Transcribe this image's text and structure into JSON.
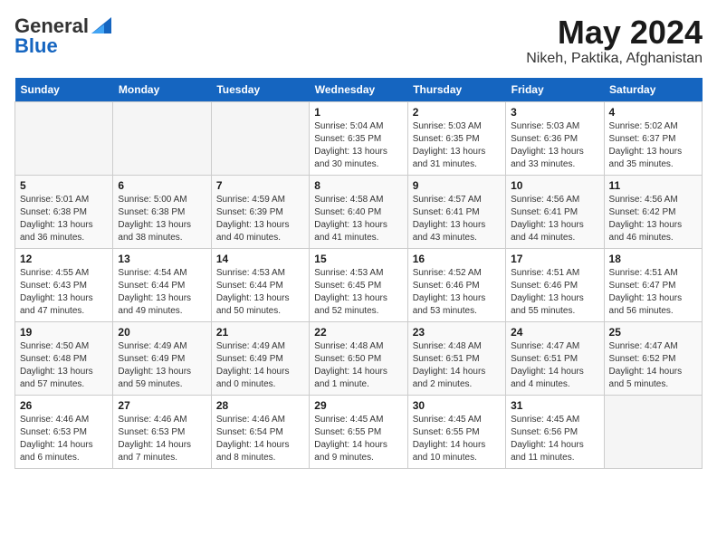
{
  "header": {
    "logo_general": "General",
    "logo_blue": "Blue",
    "title": "May 2024",
    "subtitle": "Nikeh, Paktika, Afghanistan"
  },
  "weekdays": [
    "Sunday",
    "Monday",
    "Tuesday",
    "Wednesday",
    "Thursday",
    "Friday",
    "Saturday"
  ],
  "weeks": [
    [
      {
        "day": "",
        "empty": true
      },
      {
        "day": "",
        "empty": true
      },
      {
        "day": "",
        "empty": true
      },
      {
        "day": "1",
        "sunrise": "5:04 AM",
        "sunset": "6:35 PM",
        "daylight": "13 hours and 30 minutes."
      },
      {
        "day": "2",
        "sunrise": "5:03 AM",
        "sunset": "6:35 PM",
        "daylight": "13 hours and 31 minutes."
      },
      {
        "day": "3",
        "sunrise": "5:03 AM",
        "sunset": "6:36 PM",
        "daylight": "13 hours and 33 minutes."
      },
      {
        "day": "4",
        "sunrise": "5:02 AM",
        "sunset": "6:37 PM",
        "daylight": "13 hours and 35 minutes."
      }
    ],
    [
      {
        "day": "5",
        "sunrise": "5:01 AM",
        "sunset": "6:38 PM",
        "daylight": "13 hours and 36 minutes."
      },
      {
        "day": "6",
        "sunrise": "5:00 AM",
        "sunset": "6:38 PM",
        "daylight": "13 hours and 38 minutes."
      },
      {
        "day": "7",
        "sunrise": "4:59 AM",
        "sunset": "6:39 PM",
        "daylight": "13 hours and 40 minutes."
      },
      {
        "day": "8",
        "sunrise": "4:58 AM",
        "sunset": "6:40 PM",
        "daylight": "13 hours and 41 minutes."
      },
      {
        "day": "9",
        "sunrise": "4:57 AM",
        "sunset": "6:41 PM",
        "daylight": "13 hours and 43 minutes."
      },
      {
        "day": "10",
        "sunrise": "4:56 AM",
        "sunset": "6:41 PM",
        "daylight": "13 hours and 44 minutes."
      },
      {
        "day": "11",
        "sunrise": "4:56 AM",
        "sunset": "6:42 PM",
        "daylight": "13 hours and 46 minutes."
      }
    ],
    [
      {
        "day": "12",
        "sunrise": "4:55 AM",
        "sunset": "6:43 PM",
        "daylight": "13 hours and 47 minutes."
      },
      {
        "day": "13",
        "sunrise": "4:54 AM",
        "sunset": "6:44 PM",
        "daylight": "13 hours and 49 minutes."
      },
      {
        "day": "14",
        "sunrise": "4:53 AM",
        "sunset": "6:44 PM",
        "daylight": "13 hours and 50 minutes."
      },
      {
        "day": "15",
        "sunrise": "4:53 AM",
        "sunset": "6:45 PM",
        "daylight": "13 hours and 52 minutes."
      },
      {
        "day": "16",
        "sunrise": "4:52 AM",
        "sunset": "6:46 PM",
        "daylight": "13 hours and 53 minutes."
      },
      {
        "day": "17",
        "sunrise": "4:51 AM",
        "sunset": "6:46 PM",
        "daylight": "13 hours and 55 minutes."
      },
      {
        "day": "18",
        "sunrise": "4:51 AM",
        "sunset": "6:47 PM",
        "daylight": "13 hours and 56 minutes."
      }
    ],
    [
      {
        "day": "19",
        "sunrise": "4:50 AM",
        "sunset": "6:48 PM",
        "daylight": "13 hours and 57 minutes."
      },
      {
        "day": "20",
        "sunrise": "4:49 AM",
        "sunset": "6:49 PM",
        "daylight": "13 hours and 59 minutes."
      },
      {
        "day": "21",
        "sunrise": "4:49 AM",
        "sunset": "6:49 PM",
        "daylight": "14 hours and 0 minutes."
      },
      {
        "day": "22",
        "sunrise": "4:48 AM",
        "sunset": "6:50 PM",
        "daylight": "14 hours and 1 minute."
      },
      {
        "day": "23",
        "sunrise": "4:48 AM",
        "sunset": "6:51 PM",
        "daylight": "14 hours and 2 minutes."
      },
      {
        "day": "24",
        "sunrise": "4:47 AM",
        "sunset": "6:51 PM",
        "daylight": "14 hours and 4 minutes."
      },
      {
        "day": "25",
        "sunrise": "4:47 AM",
        "sunset": "6:52 PM",
        "daylight": "14 hours and 5 minutes."
      }
    ],
    [
      {
        "day": "26",
        "sunrise": "4:46 AM",
        "sunset": "6:53 PM",
        "daylight": "14 hours and 6 minutes."
      },
      {
        "day": "27",
        "sunrise": "4:46 AM",
        "sunset": "6:53 PM",
        "daylight": "14 hours and 7 minutes."
      },
      {
        "day": "28",
        "sunrise": "4:46 AM",
        "sunset": "6:54 PM",
        "daylight": "14 hours and 8 minutes."
      },
      {
        "day": "29",
        "sunrise": "4:45 AM",
        "sunset": "6:55 PM",
        "daylight": "14 hours and 9 minutes."
      },
      {
        "day": "30",
        "sunrise": "4:45 AM",
        "sunset": "6:55 PM",
        "daylight": "14 hours and 10 minutes."
      },
      {
        "day": "31",
        "sunrise": "4:45 AM",
        "sunset": "6:56 PM",
        "daylight": "14 hours and 11 minutes."
      },
      {
        "day": "",
        "empty": true
      }
    ]
  ]
}
